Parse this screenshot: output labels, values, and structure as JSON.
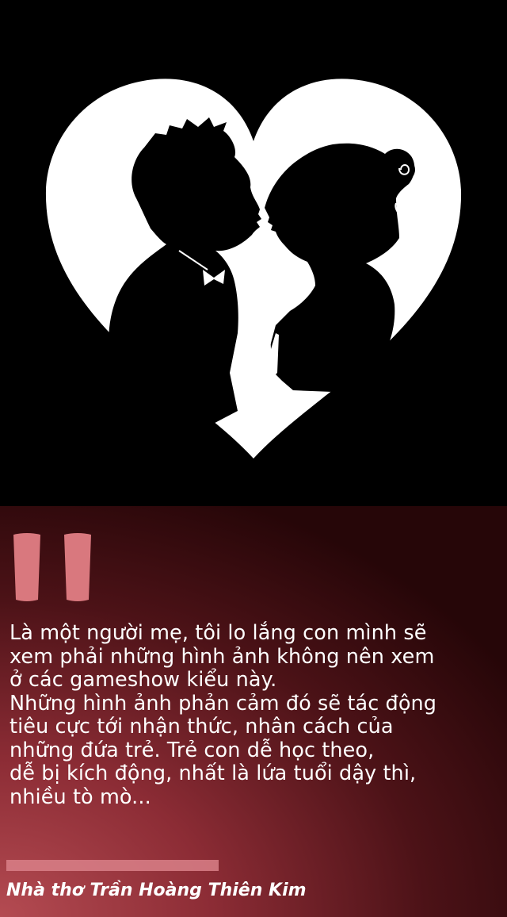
{
  "quote": {
    "lines": [
      "Là một người mẹ, tôi lo lắng con mình sẽ",
      "xem phải những hình ảnh không nên xem",
      "ở các gameshow kiểu này.",
      "Những hình ảnh phản cảm đó sẽ tác động",
      "tiêu cực tới nhận thức, nhân cách của",
      "những đứa trẻ. Trẻ con dễ học theo,",
      "dễ bị kích động, nhất là lứa tuổi dậy thì,",
      "nhiều tò mò..."
    ]
  },
  "author": "Nhà thơ Trần Hoàng Thiên Kim",
  "colors": {
    "quote_mark": "#d9787e",
    "panel_dark": "#260608",
    "panel_light": "#b44b52"
  },
  "icons": {
    "illustration": "kissing-couple-heart-silhouette",
    "quote_mark": "quotation-mark-icon"
  }
}
